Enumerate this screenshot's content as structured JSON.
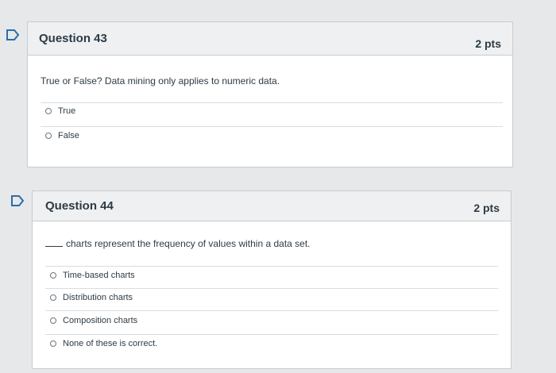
{
  "questions": [
    {
      "title": "Question 43",
      "points": "2 pts",
      "text": "True or False? Data mining only applies to numeric data.",
      "answers": [
        "True",
        "False"
      ]
    },
    {
      "title": "Question 44",
      "points": "2 pts",
      "text": "charts represent the frequency of values within a data set.",
      "answers": [
        "Time-based charts",
        "Distribution charts",
        "Composition charts",
        "None of these is correct."
      ]
    }
  ],
  "colors": {
    "flag_outline": "#2b6ea8",
    "header_bg": "#eef0f2",
    "border": "#c7cdd1"
  },
  "icons": {
    "flag": "bookmark-flag-icon",
    "radio": "radio-circle-icon"
  }
}
